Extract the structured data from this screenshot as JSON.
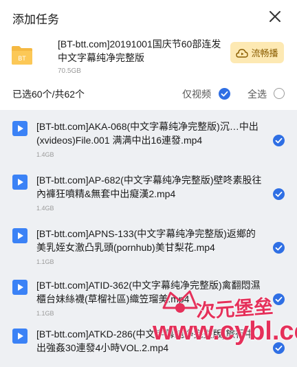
{
  "dialog": {
    "title": "添加任务"
  },
  "torrent": {
    "name": "[BT-btt.com]20191001国庆节60部连发中文字幕纯净完整版",
    "size": "70.5GB",
    "folder_label": "BT"
  },
  "play_button": {
    "label": "流畅播"
  },
  "selection": {
    "count_text": "已选60个/共62个",
    "video_only_label": "仅视频",
    "select_all_label": "全选"
  },
  "files": [
    {
      "name": "[BT-btt.com]AKA-068(中文字幕纯净完整版)沉…中出(xvideos)File.001 满满中出16連發.mp4",
      "size": "1.4GB"
    },
    {
      "name": "[BT-btt.com]AP-682(中文字幕纯净完整版)壁咚素股往內褲狂噴精&無套中出癡漢2.mp4",
      "size": "1.4GB"
    },
    {
      "name": "[BT-btt.com]APNS-133(中文字幕纯净完整版)返鄉的美乳姪女激凸乳頭(pornhub)美甘梨花.mp4",
      "size": "1.1GB"
    },
    {
      "name": "[BT-btt.com]ATID-362(中文字幕纯净完整版)禽翻悶濕櫃台妹絲襪(草榴社區)織笠瑠美.mp4",
      "size": "1.1GB"
    },
    {
      "name": "[BT-btt.com]ATKD-286(中文字幕纯净完整版)旅行中出強姦30連發4小時VOL.2.mp4",
      "size": ""
    }
  ],
  "watermark": {
    "line1": "次元堡垒",
    "line2": "www.cybl.cc"
  },
  "colors": {
    "accent": "#2f6fe4",
    "play_bg": "#fde9b3",
    "watermark": "#e5305a"
  }
}
